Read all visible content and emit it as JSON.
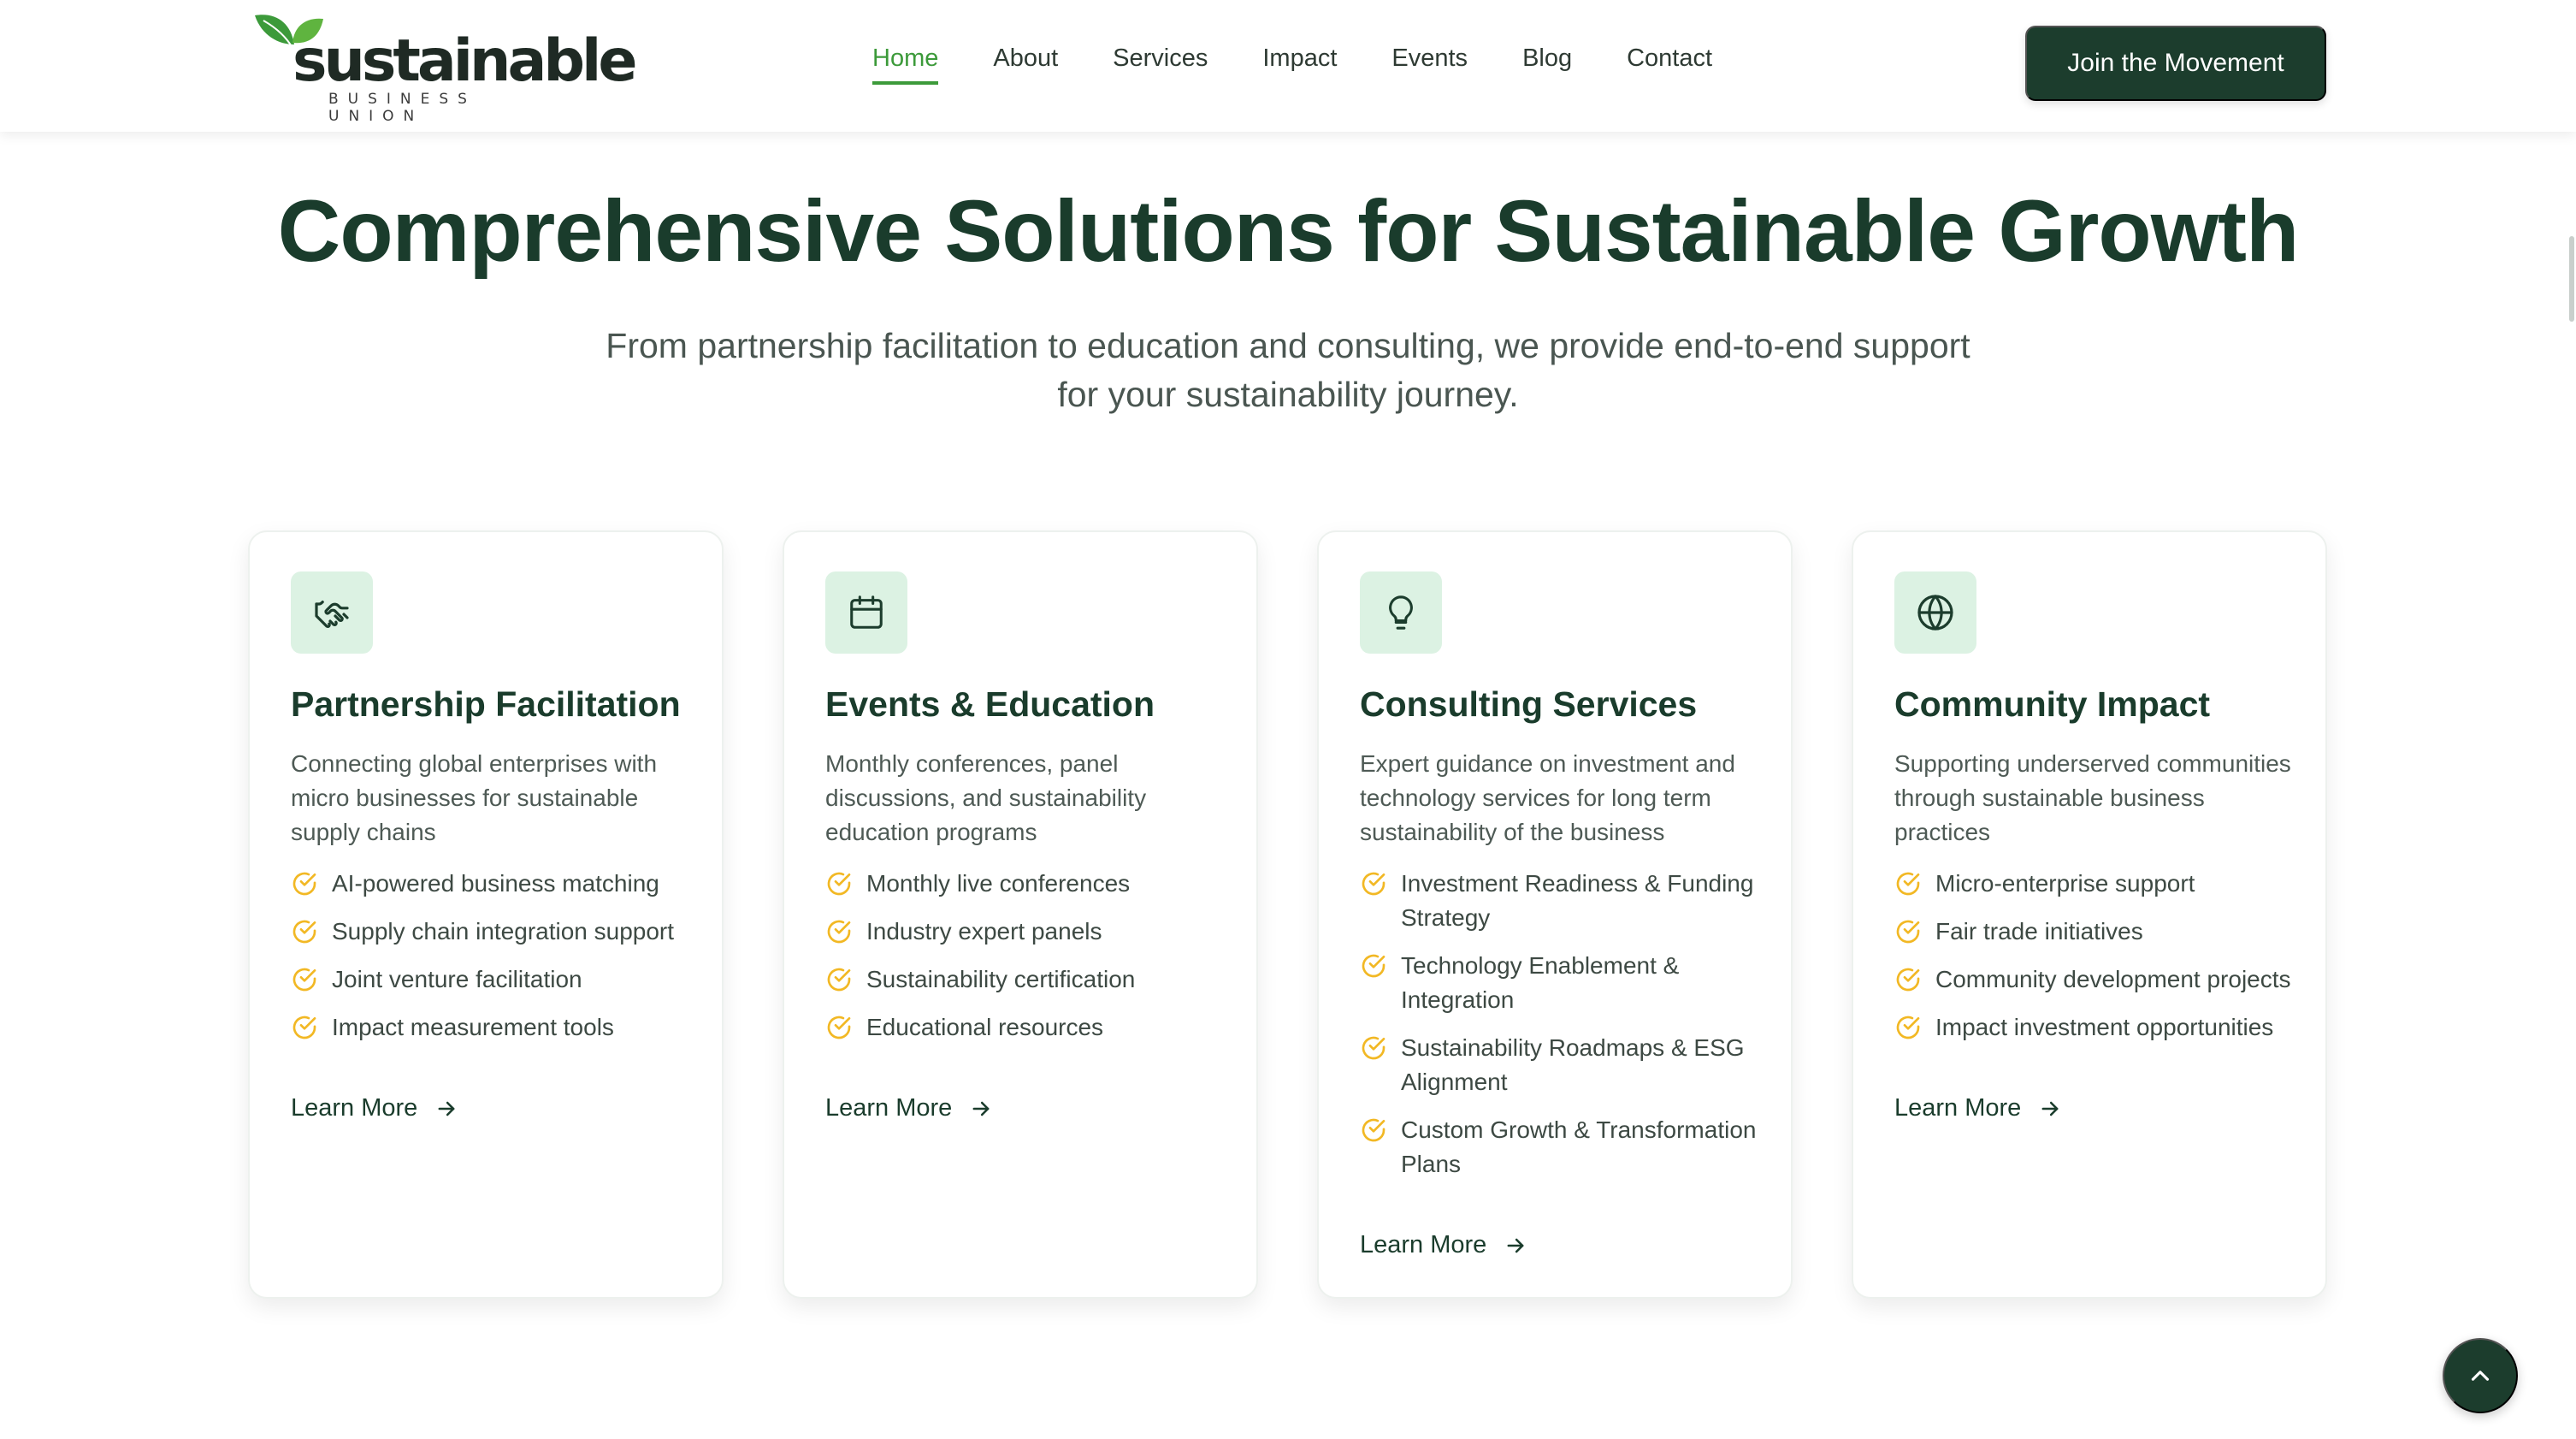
{
  "brand": {
    "name": "sustainable",
    "tagline": "BUSINESS UNION",
    "primary_color": "#1c3d2d",
    "accent_green": "#3c9a3a",
    "check_color": "#f2b824",
    "icon_bg": "#dcf2e3"
  },
  "nav": {
    "items": [
      {
        "label": "Home",
        "active": true
      },
      {
        "label": "About",
        "active": false
      },
      {
        "label": "Services",
        "active": false
      },
      {
        "label": "Impact",
        "active": false
      },
      {
        "label": "Events",
        "active": false
      },
      {
        "label": "Blog",
        "active": false
      },
      {
        "label": "Contact",
        "active": false
      }
    ],
    "cta_label": "Join the Movement"
  },
  "hero": {
    "title": "Comprehensive Solutions for Sustainable Growth",
    "subtitle": "From partnership facilitation to education and consulting, we provide end-to-end support for your sustainability journey."
  },
  "cards": [
    {
      "icon": "handshake-icon",
      "title": "Partnership Facilitation",
      "description": "Connecting global enterprises with micro businesses for sustainable supply chains",
      "features": [
        "AI-powered business matching",
        "Supply chain integration support",
        "Joint venture facilitation",
        "Impact measurement tools"
      ],
      "link_label": "Learn More"
    },
    {
      "icon": "calendar-icon",
      "title": "Events & Education",
      "description": "Monthly conferences, panel discussions, and sustainability education programs",
      "features": [
        "Monthly live conferences",
        "Industry expert panels",
        "Sustainability certification",
        "Educational resources"
      ],
      "link_label": "Learn More"
    },
    {
      "icon": "lightbulb-icon",
      "title": "Consulting Services",
      "description": "Expert guidance on investment and technology services for long term sustainability of the business",
      "features": [
        "Investment Readiness & Funding Strategy",
        "Technology Enablement & Integration",
        "Sustainability Roadmaps & ESG Alignment",
        "Custom Growth & Transformation Plans"
      ],
      "link_label": "Learn More"
    },
    {
      "icon": "globe-icon",
      "title": "Community Impact",
      "description": "Supporting underserved communities through sustainable business practices",
      "features": [
        "Micro-enterprise support",
        "Fair trade initiatives",
        "Community development projects",
        "Impact investment opportunities"
      ],
      "link_label": "Learn More"
    }
  ],
  "scroll_top": {
    "icon": "chevron-up-icon"
  }
}
